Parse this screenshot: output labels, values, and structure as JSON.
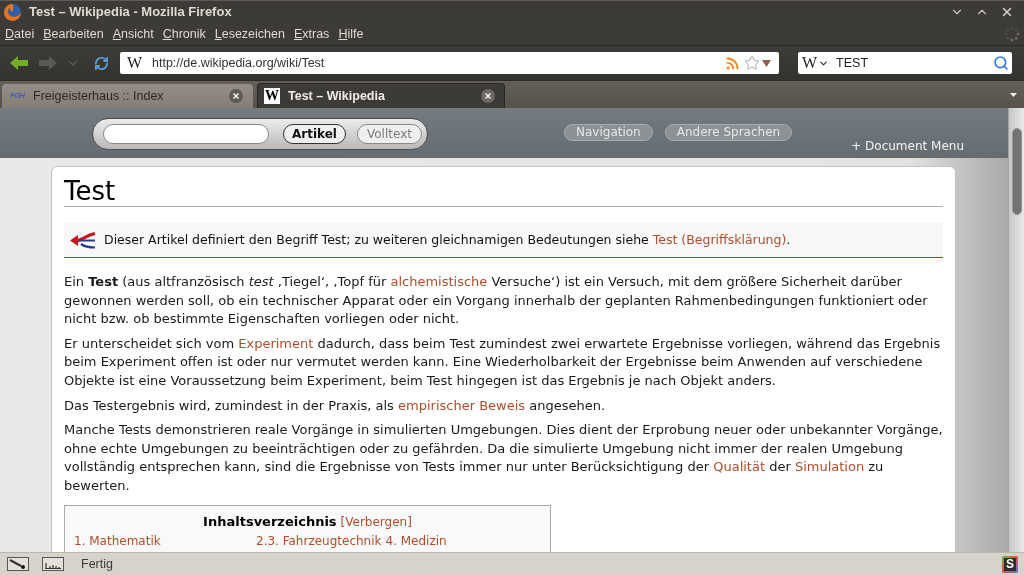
{
  "window": {
    "title": "Test – Wikipedia - Mozilla Firefox"
  },
  "menu": [
    "Datei",
    "Bearbeiten",
    "Ansicht",
    "Chronik",
    "Lesezeichen",
    "Extras",
    "Hilfe"
  ],
  "history_buttons": [
    {
      "kind": "back",
      "disabled": false
    },
    {
      "kind": "forward",
      "disabled": true
    },
    {
      "kind": "history",
      "disabled": true
    }
  ],
  "url_bar": {
    "site_icon": "W",
    "value": "http://de.wikipedia.org/wiki/Test"
  },
  "search_bar": {
    "engine_icon": "W",
    "value": "TEST"
  },
  "tabs": [
    {
      "favicon": {
        "kind": "monogram",
        "text": "FGH"
      },
      "label": "Freigeisterhaus :: Index",
      "selected": false
    },
    {
      "favicon": {
        "kind": "tile",
        "text": "W"
      },
      "label": "Test – Wikipedia",
      "selected": true
    }
  ],
  "wiki_header": {
    "search_buttons": [
      {
        "label": "Artikel",
        "kind": "primary"
      },
      {
        "label": "Volltext",
        "kind": "secondary"
      }
    ],
    "nav_buttons": [
      "Navigation",
      "Andere Sprachen"
    ],
    "document_menu": "+ Document Menu"
  },
  "article": {
    "title": "Test",
    "hatnote": [
      {
        "kind": "text",
        "text": "Dieser Artikel definiert den Begriff Test; zu weiteren gleichnamigen Bedeutungen siehe "
      },
      {
        "kind": "link",
        "text": "Test (Begriffsklärung)"
      },
      {
        "kind": "text",
        "text": "."
      }
    ],
    "paragraphs": [
      {
        "segments": [
          {
            "kind": "text",
            "text": "Ein **Test** (aus altfranzösisch *test* ‚Tiegel‘, ‚Topf für "
          },
          {
            "kind": "link",
            "text": "alchemistische"
          },
          {
            "kind": "text",
            "text": " Versuche‘) ist ein Versuch, mit dem größere Sicherheit darüber gewonnen werden soll, ob ein technischer Apparat oder ein Vorgang innerhalb der geplanten Rahmenbedingungen funktioniert oder nicht bzw. ob bestimmte Eigenschaften vorliegen oder nicht."
          }
        ]
      },
      {
        "segments": [
          {
            "kind": "text",
            "text": "Er unterscheidet sich vom "
          },
          {
            "kind": "link",
            "text": "Experiment"
          },
          {
            "kind": "text",
            "text": " dadurch, dass beim Test zumindest zwei erwartete Ergebnisse vorliegen, während das Ergebnis beim Experiment offen ist oder nur vermutet werden kann. Eine Wiederholbarkeit der Ergebnisse beim Anwenden auf verschiedene Objekte ist eine Voraussetzung beim Experiment, beim Test hingegen ist das Ergebnis je nach Objekt anders."
          }
        ]
      },
      {
        "segments": [
          {
            "kind": "text",
            "text": "Das Testergebnis wird, zumindest in der Praxis, als "
          },
          {
            "kind": "link",
            "text": "empirischer Beweis"
          },
          {
            "kind": "text",
            "text": " angesehen."
          }
        ]
      },
      {
        "segments": [
          {
            "kind": "text",
            "text": "Manche Tests demonstrieren reale Vorgänge in simulierten Umgebungen. Dies dient der Erprobung neuer oder unbekannter Vorgänge, ohne echte Umgebungen zu beeinträchtigen oder zu gefährden. Da die simulierte Umgebung nicht immer der realen Umgebung vollständig entsprechen kann, sind die Ergebnisse von Tests immer nur unter Berücksichtigung der "
          },
          {
            "kind": "link",
            "text": "Qualität"
          },
          {
            "kind": "text",
            "text": " der "
          },
          {
            "kind": "link",
            "text": "Simulation"
          },
          {
            "kind": "text",
            "text": " zu bewerten."
          }
        ]
      }
    ],
    "toc": {
      "title": "Inhaltsverzeichnis",
      "toggle": "[Verbergen]",
      "entries": [
        "1. Mathematik",
        "2.3. Fahrzeugtechnik",
        "4. Medizin"
      ]
    }
  },
  "status_bar": {
    "text": "Fertig",
    "addon_icon": "S"
  }
}
